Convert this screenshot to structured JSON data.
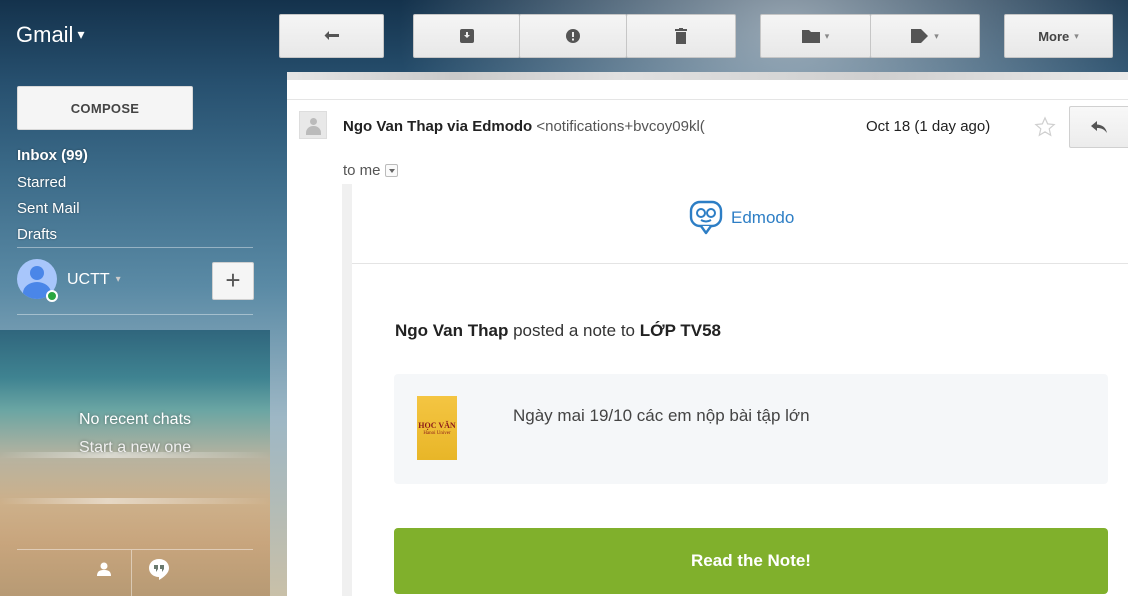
{
  "header": {
    "app_name": "Gmail",
    "app_caret": "▾"
  },
  "toolbar": {
    "back_icon": "back-arrow-icon",
    "archive_icon": "archive-icon",
    "spam_icon": "report-spam-icon",
    "delete_icon": "trash-icon",
    "move_icon": "folder-icon",
    "labels_icon": "label-tag-icon",
    "more_label": "More"
  },
  "sidebar": {
    "compose_label": "COMPOSE",
    "items": [
      {
        "label": "Inbox (99)",
        "bold": true
      },
      {
        "label": "Starred"
      },
      {
        "label": "Sent Mail"
      },
      {
        "label": "Drafts"
      }
    ],
    "account_name": "UCTT",
    "add_label": "+",
    "chats_empty": "No recent chats",
    "chats_link": "Start a new one"
  },
  "message": {
    "sender_name": "Ngo Van Thap via Edmodo",
    "sender_email": "<notifications+bvcoy09kl(",
    "date": "Oct 18 (1 day ago)",
    "to_line": "to me"
  },
  "email_body": {
    "brand_name": "Edmodo",
    "poster": "Ngo Van Thap",
    "posted_text": " posted a note to ",
    "group": "LỚP TV58",
    "note_thumb_line1": "HỌC VĂN",
    "note_thumb_line2": "Hanoi Univer",
    "note_text": "Ngày mai 19/10 các em nộp bài tập lớn",
    "cta_label": "Read the Note!"
  },
  "colors": {
    "accent_green": "#80b02c",
    "edmodo_blue": "#2d7ec5",
    "presence_green": "#2ba640"
  }
}
